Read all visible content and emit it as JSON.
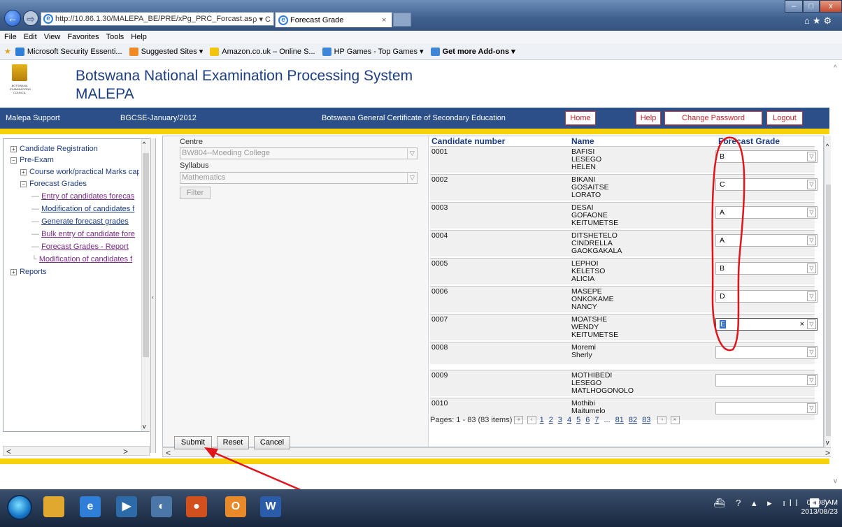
{
  "browser": {
    "url": "http://10.86.1.30/MALEPA_BE/PRE/xPg_PRC_Forcast.aspx?",
    "address_tools": "ρ ▾ C",
    "tab_title": "Forecast Grade",
    "tab_close": "×",
    "menu": [
      "File",
      "Edit",
      "View",
      "Favorites",
      "Tools",
      "Help"
    ],
    "favorites": [
      {
        "label": "Microsoft Security Essenti...",
        "color": "#2f7ed8"
      },
      {
        "label": "Suggested Sites ▾",
        "color": "#f08a24"
      },
      {
        "label": "Amazon.co.uk – Online S...",
        "color": "#f2c40c"
      },
      {
        "label": "HP Games - Top Games ▾",
        "color": "#3f86d8"
      },
      {
        "label": "Get more Add-ons ▾",
        "color": "#3f86d8"
      }
    ],
    "window_buttons": {
      "minimize": "–",
      "maximize": "□",
      "close": "x"
    },
    "right_icons": "⌂★⚙",
    "back_icon": "←",
    "forward_icon": "⇨"
  },
  "header": {
    "title_line1": "Botswana National Examination Processing System",
    "title_line2": "MALEPA",
    "logo_text": "BOTSWANA EXAMINATIONS COUNCIL"
  },
  "navstrip": {
    "support": "Malepa Support",
    "session": "BGCSE-January/2012",
    "qualification": "Botswana General Certificate of Secondary Education",
    "home": "Home",
    "help": "Help",
    "change_password": "Change Password",
    "logout": "Logout"
  },
  "tree": {
    "candidate_registration": "Candidate Registration",
    "pre_exam": "Pre-Exam",
    "course_work": "Course work/practical Marks cap",
    "forecast_grades": "Forecast Grades",
    "leaves": [
      "Entry of candidates forecas",
      "Modification of candidates f",
      "Generate forecast grades",
      "Bulk entry of candidate fore",
      "Forecast Grades - Report",
      "Modification of candidates f"
    ],
    "reports": "Reports",
    "expand_plus": "+",
    "expand_minus": "−"
  },
  "filter": {
    "centre_label": "Centre",
    "centre_value": "BW804--Moeding College",
    "syllabus_label": "Syllabus",
    "syllabus_value": "Mathematics",
    "filter_button": "Filter",
    "dropdown_glyph": "▽"
  },
  "grid": {
    "columns": [
      "Candidate number",
      "Name",
      "Forecast Grade"
    ],
    "rows": [
      {
        "number": "0001",
        "name": [
          "BAFISI",
          "LESEGO",
          "HELEN"
        ],
        "grade": "B"
      },
      {
        "number": "0002",
        "name": [
          "BIKANI",
          "GOSAITSE",
          "LORATO"
        ],
        "grade": "C"
      },
      {
        "number": "0003",
        "name": [
          "DESAI",
          "GOFAONE",
          "KEITUMETSE"
        ],
        "grade": "A"
      },
      {
        "number": "0004",
        "name": [
          "DITSHETELO",
          "CINDRELLA",
          "GAOKGAKALA"
        ],
        "grade": "A"
      },
      {
        "number": "0005",
        "name": [
          "LEPHOI",
          "KELETSO",
          "ALICIA"
        ],
        "grade": "B"
      },
      {
        "number": "0006",
        "name": [
          "MASEPE",
          "ONKOKAME",
          "NANCY"
        ],
        "grade": "D"
      },
      {
        "number": "0007",
        "name": [
          "MOATSHE",
          "WENDY",
          "KEITUMETSE"
        ],
        "grade": "E"
      },
      {
        "number": "0008",
        "name": [
          "Moremi",
          "Sherly"
        ],
        "grade": ""
      },
      {
        "number": "0009",
        "name": [
          "MOTHIBEDI",
          "LESEGO",
          "MATLHOGONOLO"
        ],
        "grade": ""
      },
      {
        "number": "0010",
        "name": [
          "Mothibi",
          "Maitumelo"
        ],
        "grade": ""
      }
    ],
    "clear_glyph": "×",
    "pager": {
      "summary": "Pages: 1 - 83 (83 items)",
      "first": "«",
      "prev": "‹",
      "pages": [
        "1",
        "2",
        "3",
        "4",
        "5",
        "6",
        "7",
        "...",
        "81",
        "82",
        "83"
      ],
      "next": "›",
      "last": "»"
    }
  },
  "actions": {
    "submit": "Submit",
    "reset": "Reset",
    "cancel": "Cancel"
  },
  "scroll": {
    "left": "<",
    "right": ">",
    "up": "^",
    "down": "v",
    "split": "‹"
  },
  "taskbar": {
    "tray": "⛴ ? ▴ ▸ ıll ◀)",
    "time": "08:08 AM",
    "date": "2013/08/23",
    "apps": [
      {
        "label": "",
        "color": "#e0a82e"
      },
      {
        "label": "e",
        "color": "#2f7ed8"
      },
      {
        "label": "▶",
        "color": "#2c6aa8"
      },
      {
        "label": "◐",
        "color": "#4a76a8"
      },
      {
        "label": "●",
        "color": "#d2501d"
      },
      {
        "label": "O",
        "color": "#e8892a"
      },
      {
        "label": "W",
        "color": "#2a5caa"
      }
    ]
  },
  "annotation_color": "#e0141b"
}
